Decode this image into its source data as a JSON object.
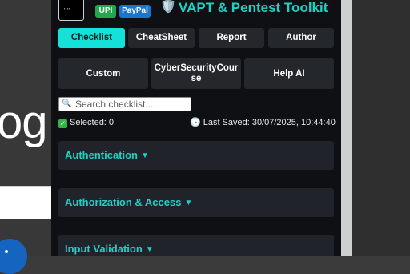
{
  "background": {
    "logo_text": "og"
  },
  "header": {
    "upi_label": "UPI",
    "paypal_label": "PayPal",
    "shield_icon": "🛡️",
    "title": "VAPT & Pentest Toolkit"
  },
  "tabs": [
    {
      "label": "Checklist",
      "active": true
    },
    {
      "label": "CheatSheet",
      "active": false
    },
    {
      "label": "Report",
      "active": false
    },
    {
      "label": "Author",
      "active": false
    }
  ],
  "secondary_buttons": [
    {
      "label": "Custom"
    },
    {
      "label": "CyberSecurityCourse"
    },
    {
      "label": "Help AI"
    }
  ],
  "search": {
    "placeholder": "Search checklist...",
    "value": ""
  },
  "status": {
    "selected_text": "Selected: 0",
    "last_saved_text": "Last Saved: 30/07/2025, 10:44:40"
  },
  "sections": [
    {
      "label": "Authentication"
    },
    {
      "label": "Authorization & Access"
    },
    {
      "label": "Input Validation"
    }
  ],
  "colors": {
    "accent": "#1fd1c5",
    "active_tab": "#14e1d8",
    "upi": "#22a84e",
    "paypal": "#1b76c9",
    "popup_bg": "#0e1013"
  }
}
